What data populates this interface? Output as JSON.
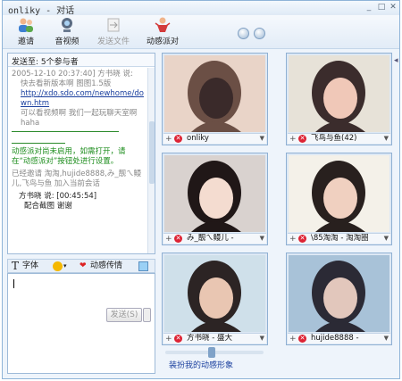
{
  "window": {
    "title": "onliky - 对话"
  },
  "titlebar": {
    "minimize": "_",
    "maximize": "□",
    "close": "✕"
  },
  "toolbar": {
    "items": [
      {
        "label": "邀请",
        "icon": "invite-icon",
        "enabled": true
      },
      {
        "label": "音视频",
        "icon": "webcam-icon",
        "enabled": true
      },
      {
        "label": "发送文件",
        "icon": "send-file-icon",
        "enabled": false
      },
      {
        "label": "动感派对",
        "icon": "party-icon",
        "enabled": true
      }
    ]
  },
  "chat": {
    "send_to": "发送至: 5个参与者",
    "log": [
      {
        "kind": "header",
        "text": "2005-12-10 20:37:40] 方书晓 说:"
      },
      {
        "kind": "gray",
        "text": "快去看新版本啊 图图1.5版"
      },
      {
        "kind": "link",
        "text": "http://xdo.sdo.com/newhome/down.htm"
      },
      {
        "kind": "gray",
        "text": "可以看视频啊 我们一起玩聊天室啊"
      },
      {
        "kind": "gray",
        "text": "haha"
      },
      {
        "kind": "green",
        "text": "动感派对尚未启用，如需打开，请在“动感派对”按钮处进行设置。"
      },
      {
        "kind": "gray",
        "text": "已经邀请 淘淘,hujide8888,み_靓ㄟ鳗儿,飞鸟与鱼 加入当前会话"
      },
      {
        "kind": "normal",
        "text": "方书晓 说: [00:45:54]"
      },
      {
        "kind": "normal",
        "text": "配合截图 谢谢"
      }
    ]
  },
  "compose": {
    "font_label": "字体",
    "emoticon_label": "",
    "party_msg_label": "动感传情",
    "send_label": "发送(S)"
  },
  "videos": [
    {
      "name": "onliky",
      "colors": [
        "#e9d4c8",
        "#6b4f45",
        "#3a2a2a"
      ]
    },
    {
      "name": "飞鸟与鱼(42)",
      "colors": [
        "#e7e2d8",
        "#3b2c2c",
        "#f0c8b8"
      ]
    },
    {
      "name": "み_靓ㄟ鳗儿 -",
      "colors": [
        "#d9d2cf",
        "#201717",
        "#f4dcd0"
      ]
    },
    {
      "name": "\\85淘淘 - 淘淘圈",
      "colors": [
        "#f4f1e9",
        "#28201e",
        "#f0d0c0"
      ]
    },
    {
      "name": "方书晓 - 盛大",
      "colors": [
        "#cfe0ea",
        "#2c2424",
        "#e9c6b2"
      ]
    },
    {
      "name": "hujide8888 -",
      "colors": [
        "#a8c2d8",
        "#2b2a35",
        "#e2c7bc"
      ]
    }
  ],
  "avatar_link": "装扮我的动感形象"
}
